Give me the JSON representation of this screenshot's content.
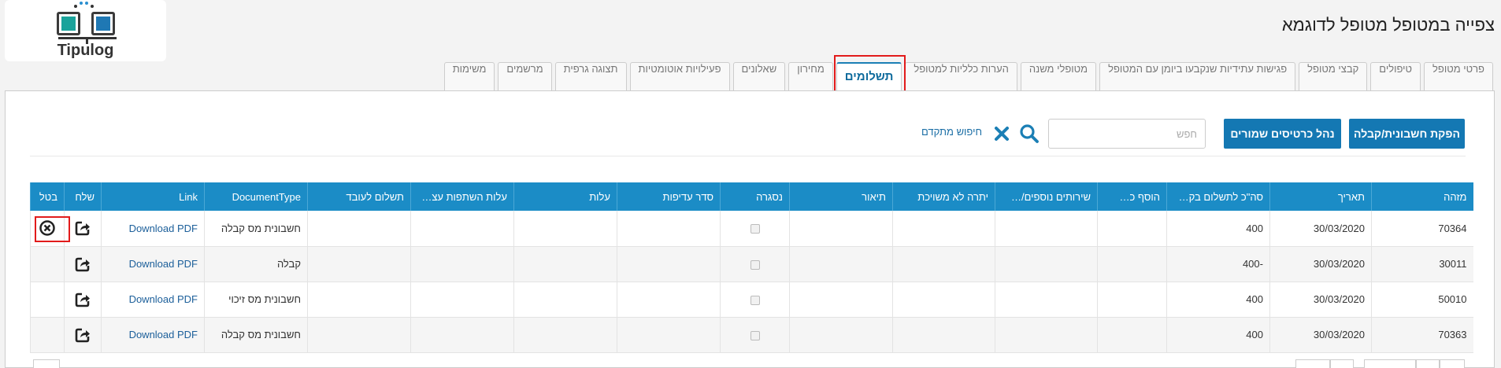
{
  "logo": {
    "name": "Tipulog"
  },
  "page_title": "צפייה במטופל מטופל לדוגמא",
  "tabs": [
    {
      "label": "פרטי מטופל",
      "active": false
    },
    {
      "label": "טיפולים",
      "active": false
    },
    {
      "label": "קבצי מטופל",
      "active": false
    },
    {
      "label": "פגישות עתידיות שנקבעו ביומן עם המטופל",
      "active": false
    },
    {
      "label": "מטופלי משנה",
      "active": false
    },
    {
      "label": "הערות כלליות למטופל",
      "active": false
    },
    {
      "label": "תשלומים",
      "active": true
    },
    {
      "label": "מחירון",
      "active": false
    },
    {
      "label": "שאלונים",
      "active": false
    },
    {
      "label": "פעילויות אוטומטיות",
      "active": false
    },
    {
      "label": "תצוגה גרפית",
      "active": false
    },
    {
      "label": "מרשמים",
      "active": false
    },
    {
      "label": "משימות",
      "active": false
    }
  ],
  "toolbar": {
    "issue_label": "הפקת חשבונית/קבלה",
    "cards_label": "נהל כרטיסים שמורים",
    "search_placeholder": "חפש",
    "advanced_search": "חיפוש מתקדם"
  },
  "table": {
    "headers": [
      "מזהה",
      "תאריך",
      "סה\"כ לתשלום בק…",
      "הוסף כ…",
      "שירותים נוספים/…",
      "יתרה לא משויכת",
      "תיאור",
      "נסגרה",
      "סדר עדיפות",
      "עלות",
      "עלות השתפות עצ…",
      "תשלום לעובד",
      "DocumentType",
      "Link",
      "שלח",
      "בטל"
    ],
    "rows": [
      {
        "id": "70364",
        "date": "30/03/2020",
        "total": "400",
        "doctype": "חשבונית מס קבלה",
        "link": "Download PDF",
        "cancellable": true
      },
      {
        "id": "30011",
        "date": "30/03/2020",
        "total": "-400",
        "doctype": "קבלה",
        "link": "Download PDF",
        "cancellable": false
      },
      {
        "id": "50010",
        "date": "30/03/2020",
        "total": "400",
        "doctype": "חשבונית מס זיכוי",
        "link": "Download PDF",
        "cancellable": false
      },
      {
        "id": "70363",
        "date": "30/03/2020",
        "total": "400",
        "doctype": "חשבונית מס קבלה",
        "link": "Download PDF",
        "cancellable": false
      }
    ]
  },
  "colors": {
    "primary": "#1478b3",
    "header": "#1b8cc6",
    "highlight": "#e21b1b",
    "active_tab_text": "#0d6a9c"
  }
}
